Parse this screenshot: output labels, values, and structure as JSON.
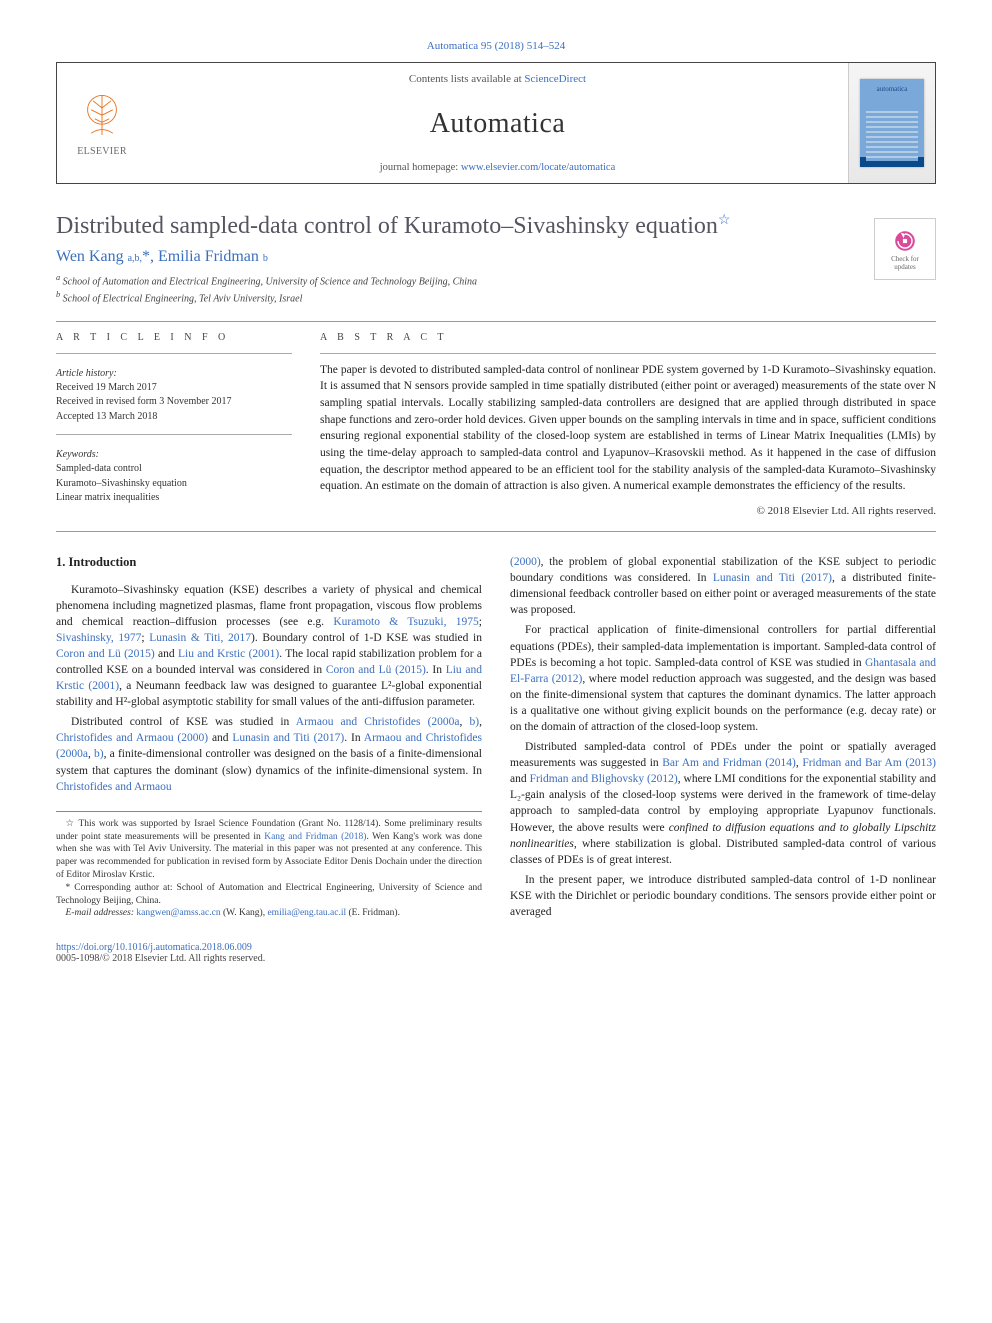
{
  "header_line": "Automatica 95 (2018) 514–524",
  "journal_box": {
    "contents_prefix": "Contents lists available at ",
    "contents_link": "ScienceDirect",
    "journal_name": "Automatica",
    "homepage_prefix": "journal homepage: ",
    "homepage_link": "www.elsevier.com/locate/automatica",
    "publisher_name": "ELSEVIER"
  },
  "article_title": "Distributed sampled-data control of Kuramoto–Sivashinsky equation",
  "title_star": "☆",
  "authors_html": "Wen Kang <span class='sup'>a,b,</span>*, Emilia Fridman <span class='sup'>b</span>",
  "affiliations": {
    "a": "School of Automation and Electrical Engineering, University of Science and Technology Beijing, China",
    "b": "School of Electrical Engineering, Tel Aviv University, Israel"
  },
  "updates_badge": {
    "line1": "Check for",
    "line2": "updates"
  },
  "labels": {
    "article_info": "A R T I C L E   I N F O",
    "abstract": "A B S T R A C T"
  },
  "history": {
    "title": "Article history:",
    "received": "Received 19 March 2017",
    "revised": "Received in revised form 3 November 2017",
    "accepted": "Accepted 13 March 2018"
  },
  "keywords": {
    "title": "Keywords:",
    "items": [
      "Sampled-data control",
      "Kuramoto–Sivashinsky equation",
      "Linear matrix inequalities"
    ]
  },
  "abstract_text": "The paper is devoted to distributed sampled-data control of nonlinear PDE system governed by 1-D Kuramoto–Sivashinsky equation. It is assumed that N sensors provide sampled in time spatially distributed (either point or averaged) measurements of the state over N sampling spatial intervals. Locally stabilizing sampled-data controllers are designed that are applied through distributed in space shape functions and zero-order hold devices. Given upper bounds on the sampling intervals in time and in space, sufficient conditions ensuring regional exponential stability of the closed-loop system are established in terms of Linear Matrix Inequalities (LMIs) by using the time-delay approach to sampled-data control and Lyapunov–Krasovskii method. As it happened in the case of diffusion equation, the descriptor method appeared to be an efficient tool for the stability analysis of the sampled-data Kuramoto–Sivashinsky equation. An estimate on the domain of attraction is also given. A numerical example demonstrates the efficiency of the results.",
  "copyright": "© 2018 Elsevier Ltd. All rights reserved.",
  "section_heading": "1. Introduction",
  "paragraphs": {
    "p1a": "Kuramoto–Sivashinsky equation (KSE) describes a variety of physical and chemical phenomena including magnetized plasmas, flame front propagation, viscous flow problems and chemical reaction–diffusion processes (see e.g. ",
    "p1_ref1": "Kuramoto & Tsuzuki, 1975",
    "p1b": "; ",
    "p1_ref2": "Sivashinsky, 1977",
    "p1c": "; ",
    "p1_ref3": "Lunasin & Titi, 2017",
    "p1d": "). Boundary control of 1-D KSE was studied in ",
    "p1_ref4": "Coron and Lü (2015)",
    "p1e": " and ",
    "p1_ref5": "Liu and Krstic (2001)",
    "p1f": ". The local rapid stabilization problem for a controlled KSE on a bounded interval was considered in ",
    "p1_ref6": "Coron and Lü (2015)",
    "p1g": ". In ",
    "p1_ref7": "Liu and Krstic (2001)",
    "p1h": ", a Neumann feedback law was designed to guarantee L²-global exponential stability and H²-global asymptotic stability for small values of the anti-diffusion parameter.",
    "p2a": "Distributed control of KSE was studied in ",
    "p2_ref1": "Armaou and Christofides (2000a",
    "p2_ref1b": ", ",
    "p2_ref1c": "b)",
    "p2b": ", ",
    "p2_ref2": "Christofides and Armaou (2000)",
    "p2c": " and ",
    "p2_ref3": "Lunasin and Titi (2017)",
    "p2d": ". In ",
    "p2_ref4": "Armaou and Christofides (2000a",
    "p2_ref4b": ", ",
    "p2_ref4c": "b)",
    "p2e": ", a finite-dimensional controller was designed on the basis of a finite-dimensional system that captures the dominant (slow) dynamics of the infinite-dimensional system. In ",
    "p2_ref5": "Christofides and Armaou",
    "p3a": "(2000)",
    "p3b": ", the problem of global exponential stabilization of the KSE subject to periodic boundary conditions was considered. In ",
    "p3_ref1": "Lunasin and Titi (2017)",
    "p3c": ", a distributed finite-dimensional feedback controller based on either point or averaged measurements of the state was proposed.",
    "p4a": "For practical application of finite-dimensional controllers for partial differential equations (PDEs), their sampled-data implementation is important. Sampled-data control of PDEs is becoming a hot topic. Sampled-data control of KSE was studied in ",
    "p4_ref1": "Ghantasala and El-Farra (2012)",
    "p4b": ", where model reduction approach was suggested, and the design was based on the finite-dimensional system that captures the dominant dynamics. The latter approach is a qualitative one without giving explicit bounds on the performance (e.g. decay rate) or on the domain of attraction of the closed-loop system.",
    "p5a": "Distributed sampled-data control of PDEs under the point or spatially averaged measurements was suggested in ",
    "p5_ref1": "Bar Am and Fridman (2014)",
    "p5b": ", ",
    "p5_ref2": "Fridman and Bar Am (2013)",
    "p5c": " and ",
    "p5_ref3": "Fridman and Blighovsky (2012)",
    "p5d": ", where LMI conditions for the exponential stability and L₂-gain analysis of the closed-loop systems were derived in the framework of time-delay approach to sampled-data control by employing appropriate Lyapunov functionals. However, the above results were ",
    "p5_em": "confined to diffusion equations and to globally Lipschitz nonlinearities",
    "p5e": ", where stabilization is global. Distributed sampled-data control of various classes of PDEs is of great interest.",
    "p6a": "In the present paper, we introduce distributed sampled-data control of 1-D nonlinear KSE with the Dirichlet or periodic boundary conditions. The sensors provide either point or averaged"
  },
  "footnotes": {
    "star": "This work was supported by Israel Science Foundation (Grant No. 1128/14). Some preliminary results under point state measurements will be presented in ",
    "star_ref": "Kang and Fridman (2018)",
    "star_b": ". Wen Kang's work was done when she was with Tel Aviv University. The material in this paper was not presented at any conference. This paper was recommended for publication in revised form by Associate Editor Denis Dochain under the direction of Editor Miroslav Krstic.",
    "corr_label": "*",
    "corr_text": "Corresponding author at: School of Automation and Electrical Engineering, University of Science and Technology Beijing, China.",
    "email_label": "E-mail addresses:",
    "email1": "kangwen@amss.ac.cn",
    "email1_name": "(W. Kang),",
    "email2": "emilia@eng.tau.ac.il",
    "email2_name": "(E. Fridman)."
  },
  "footer": {
    "doi": "https://doi.org/10.1016/j.automatica.2018.06.009",
    "issn": "0005-1098/© 2018 Elsevier Ltd. All rights reserved."
  }
}
